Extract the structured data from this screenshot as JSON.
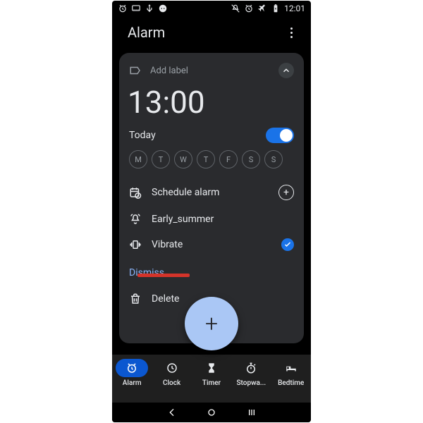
{
  "status": {
    "time": "12:01"
  },
  "appbar": {
    "title": "Alarm"
  },
  "alarm": {
    "add_label": "Add label",
    "time": "13:00",
    "today": "Today",
    "days": [
      "M",
      "T",
      "W",
      "T",
      "F",
      "S",
      "S"
    ],
    "schedule": "Schedule alarm",
    "sound": "Early_summer",
    "vibrate": "Vibrate",
    "dismiss": "Dismiss",
    "delete": "Delete"
  },
  "nav": {
    "alarm": "Alarm",
    "clock": "Clock",
    "timer": "Timer",
    "stopwatch": "Stopwa...",
    "bedtime": "Bedtime"
  }
}
